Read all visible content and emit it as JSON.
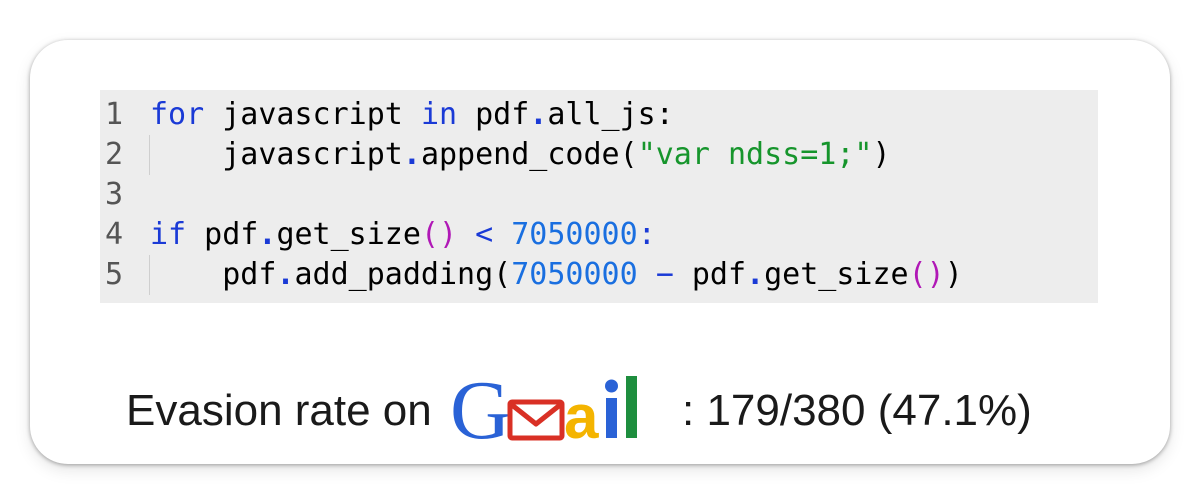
{
  "code": {
    "lines": [
      {
        "num": "1"
      },
      {
        "num": "2"
      },
      {
        "num": "3"
      },
      {
        "num": "4"
      },
      {
        "num": "5"
      }
    ],
    "tokens": {
      "l1_for": "for ",
      "l1_var": "javascript ",
      "l1_in": "in",
      "l1_obj": " pdf",
      "l1_dot": ".",
      "l1_attr": "all_js:",
      "l2_indent": "    ",
      "l2_obj": "javascript",
      "l2_dot": ".",
      "l2_call": "append_code(",
      "l2_str": "\"var ndss=1;\"",
      "l2_close": ")",
      "l4_if": "if",
      "l4_obj": " pdf",
      "l4_dot": ".",
      "l4_call": "get_size",
      "l4_parens": "()",
      "l4_lt": " < ",
      "l4_num": "7050000",
      "l4_colon": ":",
      "l5_indent": "    ",
      "l5_obj": "pdf",
      "l5_dot": ".",
      "l5_call": "add_padding(",
      "l5_num": "7050000",
      "l5_minus": " − ",
      "l5_obj2": "pdf",
      "l5_dot2": ".",
      "l5_call2": "get_size",
      "l5_parens": "()",
      "l5_close": ")"
    }
  },
  "evasion": {
    "label": "Evasion rate on",
    "logo_text": "Gmail",
    "value": ": 179/380 (47.1%)"
  },
  "colors": {
    "keyword": "#1a3ad6",
    "string": "#16952c",
    "number": "#1a6fe0",
    "paren": "#b018b6",
    "gmail_blue": "#2a62d6",
    "gmail_red": "#d93025",
    "gmail_yellow": "#f4b400",
    "gmail_green": "#1e8e3e"
  }
}
